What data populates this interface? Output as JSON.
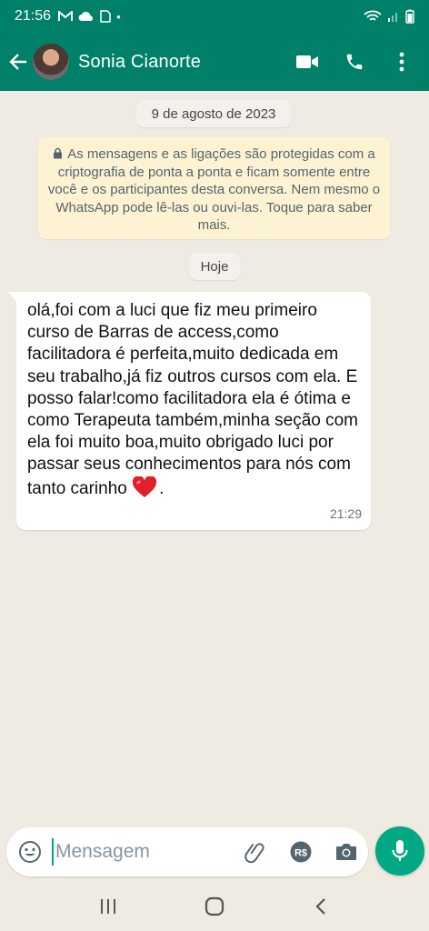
{
  "status_bar": {
    "time": "21:56"
  },
  "header": {
    "contact_name": "Sonia Cianorte"
  },
  "chat": {
    "date_label": "9 de agosto de 2023",
    "encryption_notice": "As mensagens e as ligações são protegidas com a criptografia de ponta a ponta e ficam somente entre você e os participantes desta conversa. Nem mesmo o WhatsApp pode lê-las ou ouvi-las. Toque para saber mais.",
    "today_label": "Hoje",
    "message": {
      "text": "olá,foi com a luci que fiz meu  primeiro curso de Barras de access,como facilitadora é perfeita,muito dedicada em seu trabalho,já fiz outros cursos com ela. E posso falar!como facilitadora ela é ótima e como Terapeuta também,minha seção com ela foi muito boa,muito obrigado luci por passar seus conhecimentos para nós com tanto carinho",
      "ending": ".",
      "time": "21:29"
    }
  },
  "composer": {
    "placeholder": "Mensagem"
  },
  "colors": {
    "header": "#008069",
    "accent": "#00a884",
    "background": "#efeae2",
    "notice_bg": "#fdf3d2"
  },
  "icons": [
    "back-arrow-icon",
    "video-call-icon",
    "phone-icon",
    "more-options-icon",
    "lock-icon",
    "heart-emoji-icon",
    "emoji-icon",
    "attach-icon",
    "payment-icon",
    "camera-icon",
    "mic-icon"
  ]
}
